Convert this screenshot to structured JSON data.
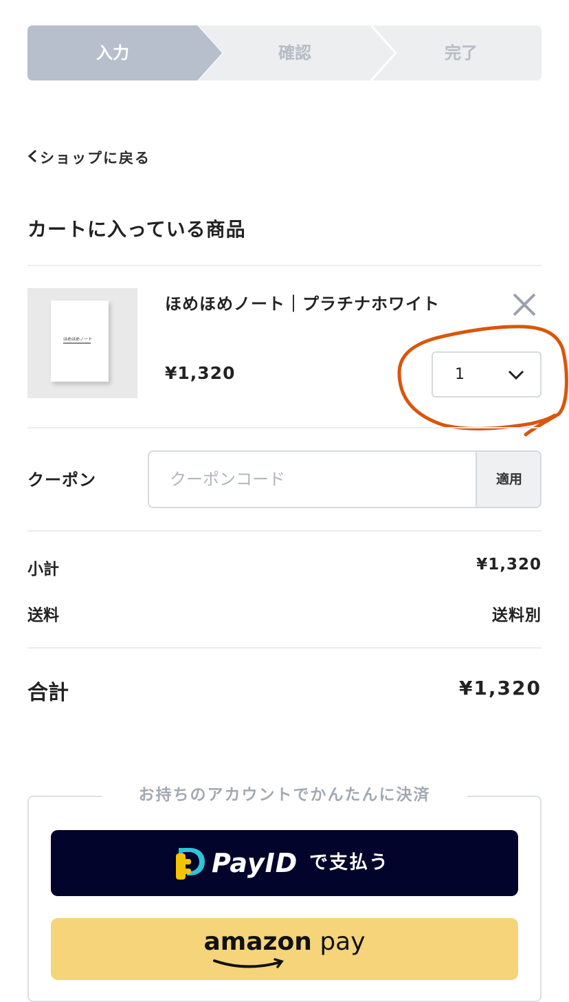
{
  "stepper": {
    "steps": [
      {
        "label": "入力",
        "active": true
      },
      {
        "label": "確認",
        "active": false
      },
      {
        "label": "完了",
        "active": false
      }
    ],
    "active_color": "#b6bfcb",
    "inactive_color": "#eceef0"
  },
  "nav": {
    "back_label": "ショップに戻る"
  },
  "cart": {
    "title": "カートに入っている商品",
    "item": {
      "name": "ほめほめノート｜プラチナホワイト",
      "thumbnail_text": "ほめほめノート",
      "price": "¥1,320",
      "quantity": "1"
    }
  },
  "coupon": {
    "label": "クーポン",
    "placeholder": "クーポンコード",
    "apply_label": "適用"
  },
  "summary": {
    "subtotal_label": "小計",
    "subtotal_value": "¥1,320",
    "shipping_label": "送料",
    "shipping_value": "送料別",
    "total_label": "合計",
    "total_value": "¥1,320"
  },
  "payment": {
    "legend": "お持ちのアカウントでかんたんに決済",
    "payid_brand": "PayID",
    "payid_suffix": "で支払う",
    "amazon_brand": "amazon",
    "amazon_suffix": "pay",
    "payid_bg": "#03042b",
    "amazon_bg": "#f5d47a"
  },
  "annotation_color": "#d9560b"
}
